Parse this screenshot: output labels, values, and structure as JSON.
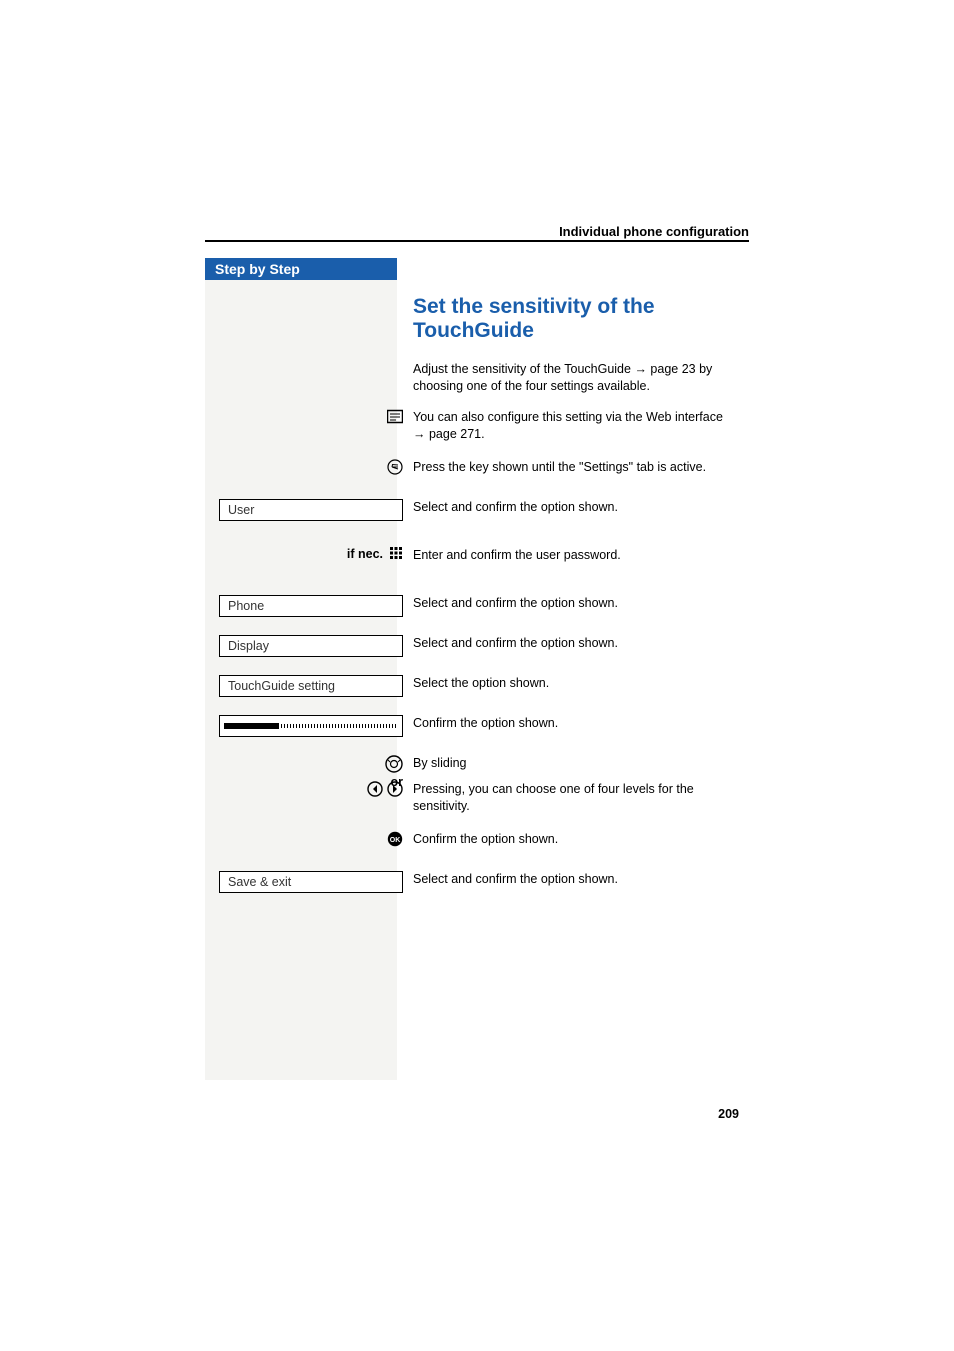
{
  "header": {
    "section": "Individual phone configuration"
  },
  "sidebar": {
    "title": "Step by Step"
  },
  "content": {
    "heading": "Set the sensitivity of the TouchGuide",
    "intro_part1": "Adjust the sensitivity of the TouchGuide ",
    "intro_pageref": "page 23",
    "intro_part2": " by choosing one of the four settings available.",
    "web_part1": "You can also configure this setting via the Web interface ",
    "web_pageref": "page 271",
    "web_part2": "."
  },
  "steps": {
    "press_settings": "Press the key shown until the \"Settings\" tab is active.",
    "user_box": "User",
    "user_text": "Select and confirm the option shown.",
    "ifnec_label": "if nec.",
    "ifnec_text": "Enter and confirm the user password.",
    "phone_box": "Phone",
    "phone_text": "Select and confirm the option shown.",
    "display_box": "Display",
    "display_text": "Select and confirm the option shown.",
    "touchguide_box": "TouchGuide setting",
    "touchguide_text": "Select the option shown.",
    "slider_confirm": "Confirm the option shown.",
    "sliding_text": "By sliding",
    "or_label": "or",
    "pressing_text": "Pressing, you can choose one of four levels for the sensitivity.",
    "ok_confirm": "Confirm the option shown.",
    "save_box": "Save & exit",
    "save_text": "Select and confirm the option shown."
  },
  "footer": {
    "page": "209"
  }
}
